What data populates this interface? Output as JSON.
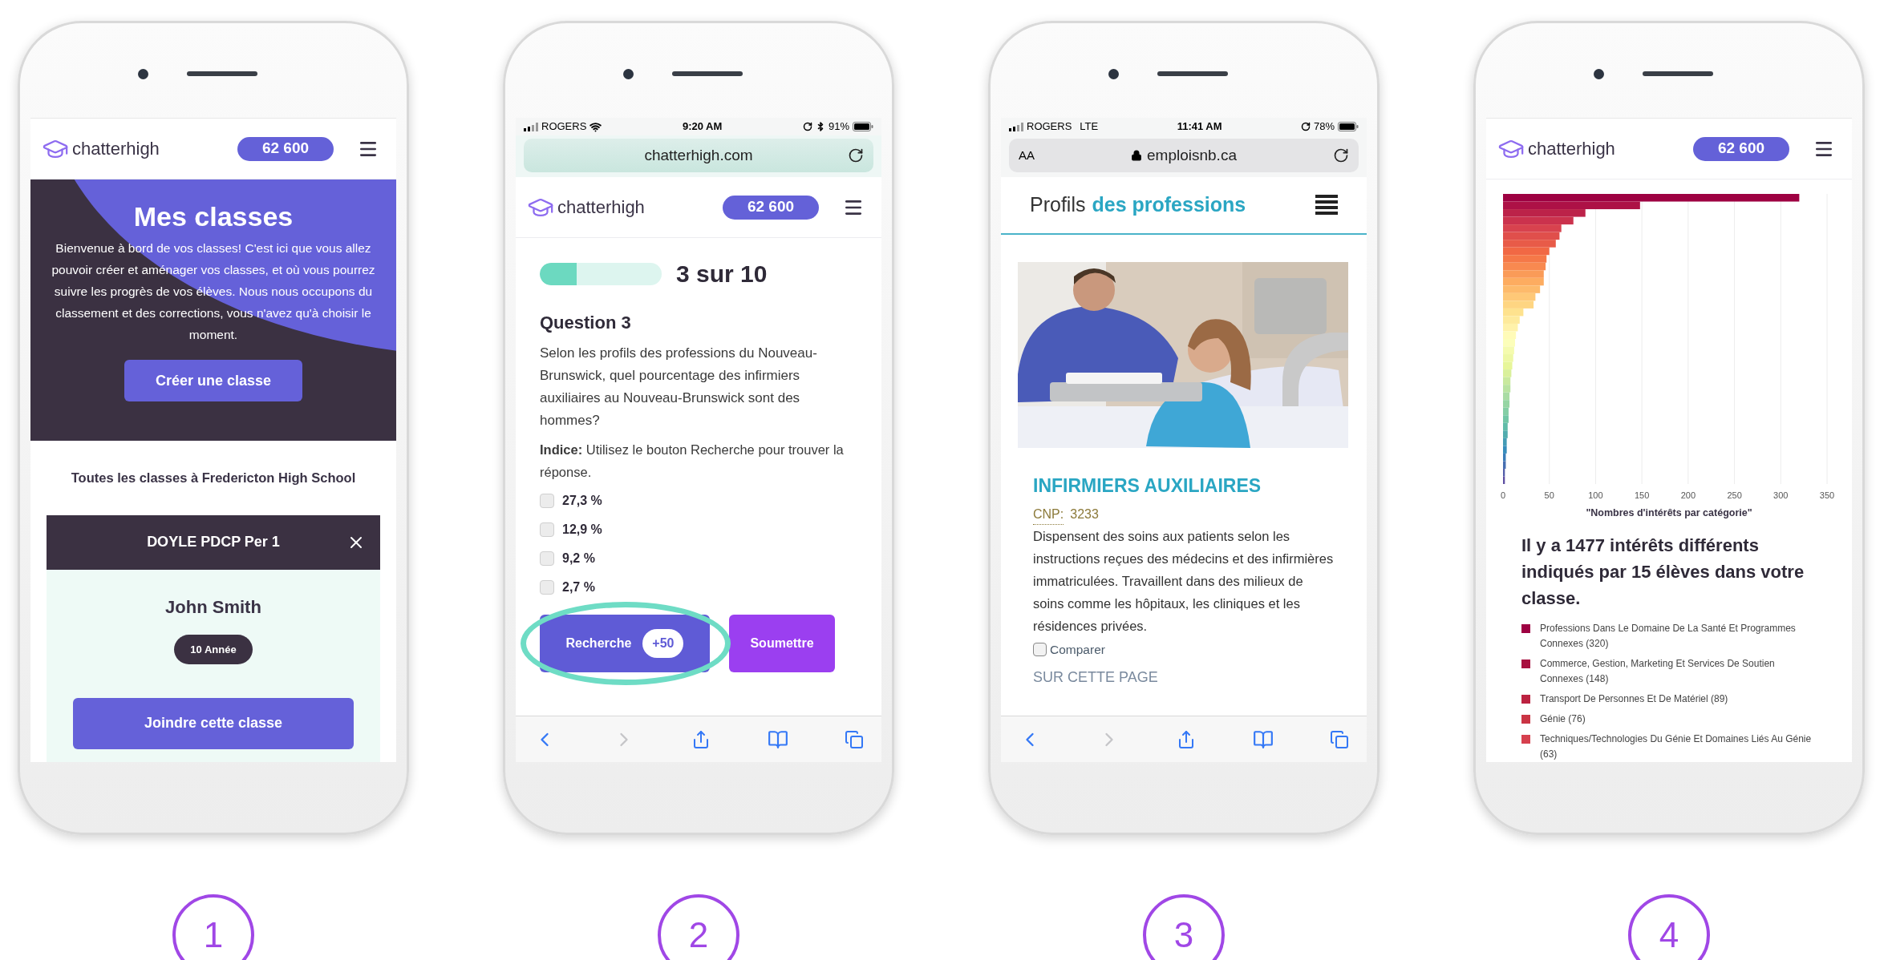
{
  "phones": [
    {
      "kind": "classes",
      "step": "1",
      "header": {
        "logo": "chatterhigh",
        "points": "62 600"
      },
      "hero": {
        "title": "Mes classes",
        "text": "Bienvenue à bord de vos classes! C'est ici que vous allez pouvoir créer et aménager vos classes, et où vous pourrez suivre les progrès de vos élèves. Nous nous occupons du classement et des corrections, vous n'avez qu'à choisir le moment.",
        "button": "Créer une classe"
      },
      "school_heading": "Toutes les classes à Fredericton High School",
      "class_card": {
        "title": "DOYLE PDCP Per 1",
        "student": "John Smith",
        "grade": "10 Année",
        "button": "Joindre cette classe"
      }
    },
    {
      "kind": "quiz",
      "step": "2",
      "status_bar": {
        "carrier": "ROGERS",
        "wifi": true,
        "time": "9:20 AM",
        "bluetooth": true,
        "battery": "91%"
      },
      "url_bar": {
        "url": "chatterhigh.com"
      },
      "header": {
        "logo": "chatterhigh",
        "points": "62 600"
      },
      "progress": {
        "level": 0.3,
        "label": "3 sur 10"
      },
      "question": {
        "title": "Question 3",
        "text": "Selon les profils des professions du Nouveau-Brunswick, quel pourcentage des infirmiers auxiliaires au Nouveau-Brunswick sont des hommes?",
        "hint": "**Indice:** Utilisez le bouton Recherche pour trouver la réponse.",
        "options": [
          {
            "label": "27,3 %",
            "checked": false
          },
          {
            "label": "12,9 %",
            "checked": false
          },
          {
            "label": "9,2 %",
            "checked": false
          },
          {
            "label": "2,7 %",
            "checked": false
          }
        ]
      },
      "buttons": {
        "search": "Recherche",
        "bonus": "+50",
        "submit": "Soumettre"
      }
    },
    {
      "kind": "profile",
      "step": "3",
      "status_bar": {
        "carrier": "ROGERS",
        "network": "LTE",
        "time": "11:41 AM",
        "battery": "78%"
      },
      "url_bar": {
        "text_size": "AA",
        "url": "emploisnb.ca",
        "secure": true
      },
      "site_header": {
        "title_start": "Profils",
        "title_highlight": "des professions"
      },
      "profession": {
        "title": "INFIRMIERS AUXILIAIRES",
        "code_label": "CNP:",
        "code": "3233",
        "description": "Dispensent des soins aux patients selon les instructions reçues des médecins et des infirmières immatriculées. Travaillent dans des milieux de soins comme les hôpitaux, les cliniques et les résidences privées.",
        "compare": {
          "label": "Comparer",
          "checked": false
        }
      },
      "section_label": "SUR CETTE PAGE"
    },
    {
      "kind": "interests",
      "step": "4",
      "header": {
        "logo": "chatterhigh",
        "points": "62 600"
      },
      "chart_data": {
        "type": "bar",
        "orientation": "horizontal",
        "xlabel": "\"Nombres d'intérêts par catégorie\"",
        "xlim": [
          0,
          350
        ],
        "xticks": [
          0,
          50,
          100,
          150,
          200,
          250,
          300,
          350
        ],
        "grid": true,
        "values": [
          320,
          148,
          89,
          76,
          63,
          61,
          57,
          50,
          47,
          46,
          44,
          44,
          40,
          35,
          33,
          22,
          18,
          16,
          14,
          13,
          12,
          11,
          10,
          9,
          8,
          8,
          7,
          7,
          6,
          6,
          5,
          5,
          4,
          4,
          3,
          3,
          2,
          2
        ]
      },
      "summary": "Il y a 1477 intérêts différents indiqués par 15 élèves dans votre classe.",
      "legend": [
        {
          "label": "Professions Dans Le Domaine De La Santé Et Programmes Connexes (320)",
          "color": "#9e0142"
        },
        {
          "label": "Commerce, Gestion, Marketing Et Services De Soutien Connexes (148)",
          "color": "#a8103f"
        },
        {
          "label": "Transport De Personnes Et De Matériel (89)",
          "color": "#bc2240"
        },
        {
          "label": "Génie (76)",
          "color": "#ca3444"
        },
        {
          "label": "Techniques/Technologies Du Génie Et Domaines Liés Au Génie (63)",
          "color": "#d6404e"
        }
      ]
    }
  ]
}
